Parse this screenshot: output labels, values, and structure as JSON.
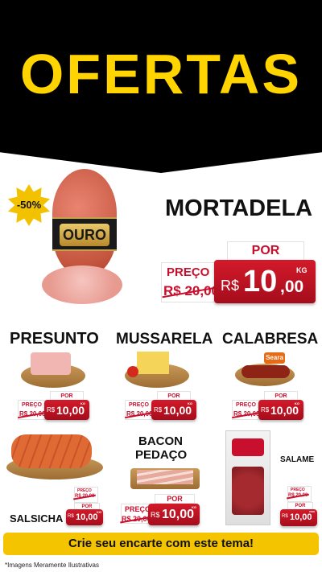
{
  "header": {
    "title": "OFERTAS"
  },
  "featured": {
    "discount_badge": "-50%",
    "brand_label": "OURO",
    "name": "MORTADELA",
    "preco_label": "PREÇO",
    "old_price": "R$ 20,00",
    "por_label": "POR",
    "currency": "R$",
    "price_int": "10",
    "price_dec": ",00",
    "unit": "KG"
  },
  "products": [
    {
      "name": "PRESUNTO",
      "preco_label": "PREÇO",
      "old_price": "R$ 20,00",
      "por_label": "POR",
      "currency": "R$",
      "price": "10,00",
      "unit": "KG"
    },
    {
      "name": "MUSSARELA",
      "preco_label": "PREÇO",
      "old_price": "R$ 20,00",
      "por_label": "POR",
      "currency": "R$",
      "price": "10,00",
      "unit": "KG"
    },
    {
      "name": "CALABRESA",
      "preco_label": "PREÇO",
      "old_price": "R$ 20,00",
      "por_label": "POR",
      "currency": "R$",
      "price": "10,00",
      "unit": "KG",
      "brand": "Seara"
    },
    {
      "name": "SALSICHA",
      "preco_label": "PREÇO",
      "old_price": "R$ 20,00",
      "por_label": "POR",
      "currency": "R$",
      "price": "10,00",
      "unit": "KG"
    },
    {
      "name_line1": "BACON",
      "name_line2": "PEDAÇO",
      "preco_label": "PREÇO",
      "old_price": "R$ 20,00",
      "por_label": "POR",
      "currency": "R$",
      "price": "10,00",
      "unit": "KG"
    },
    {
      "name": "SALAME",
      "preco_label": "PREÇO",
      "old_price": "R$ 20,00",
      "por_label": "POR",
      "currency": "R$",
      "price": "10,00",
      "unit": "UNID"
    }
  ],
  "footer": {
    "cta": "Crie seu encarte com este tema!",
    "note": "*Imagens Meramente Ilustrativas"
  },
  "colors": {
    "header_bg": "#000000",
    "title_yellow": "#ffd400",
    "price_red": "#c8102e",
    "cta_yellow": "#f5c400"
  }
}
